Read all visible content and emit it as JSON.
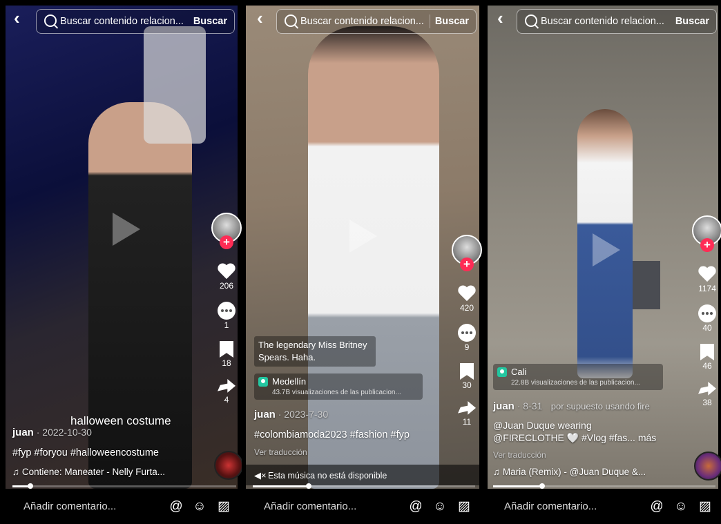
{
  "panels": [
    {
      "search_placeholder": "Buscar contenido relacion...",
      "search_button": "Buscar",
      "overlay_text": "halloween costume",
      "username": "juan",
      "date": " · 2022-10-30",
      "hashtags": "#fyp #foryou #halloweencostume",
      "music": "♫ Contiene: Maneater - Nelly Furta...",
      "counts": {
        "likes": "206",
        "comments": "1",
        "saves": "18",
        "shares": "4"
      },
      "comment_placeholder": "Añadir comentario...",
      "progress": 0.08
    },
    {
      "search_placeholder": "Buscar contenido relacion...",
      "search_button": "Buscar",
      "caption_box": "The legendary Miss Britney\nSpears. Haha.",
      "location_city": "Medellín",
      "location_views": "43.7B visualizaciones de las publicacion...",
      "username": "juan",
      "date": " · 2023-7-30",
      "hashtags": "#colombiamoda2023 #fashion #fyp",
      "translate": "Ver traducción",
      "music": "Esta música no está disponible",
      "counts": {
        "likes": "420",
        "comments": "9",
        "saves": "30",
        "shares": "11"
      },
      "comment_placeholder": "Añadir comentario...",
      "progress": 0.25
    },
    {
      "search_placeholder": "Buscar contenido relacion...",
      "search_button": "Buscar",
      "location_city": "Cali",
      "location_views": "22.8B visualizaciones de las publicacion...",
      "username": "juan",
      "date": " · 8-31",
      "subcaption": "por supuesto usando fire",
      "desc_line1": "@Juan Duque wearing",
      "desc_line2": "@FIRECLOTHE 🤍 #Vlog #fas... más",
      "translate": "Ver traducción",
      "music": "♫ Maria (Remix) - @Juan Duque &...",
      "counts": {
        "likes": "1174",
        "comments": "40",
        "saves": "46",
        "shares": "38"
      },
      "comment_placeholder": "Añadir comentario...",
      "progress": 0.22
    }
  ],
  "icons": {
    "back": "chevron-left-icon",
    "search": "search-icon",
    "mention": "at-icon",
    "emoji": "emoji-icon",
    "image": "image-icon"
  },
  "colors": {
    "accent": "#fe2c55",
    "location": "#23c6a0"
  }
}
